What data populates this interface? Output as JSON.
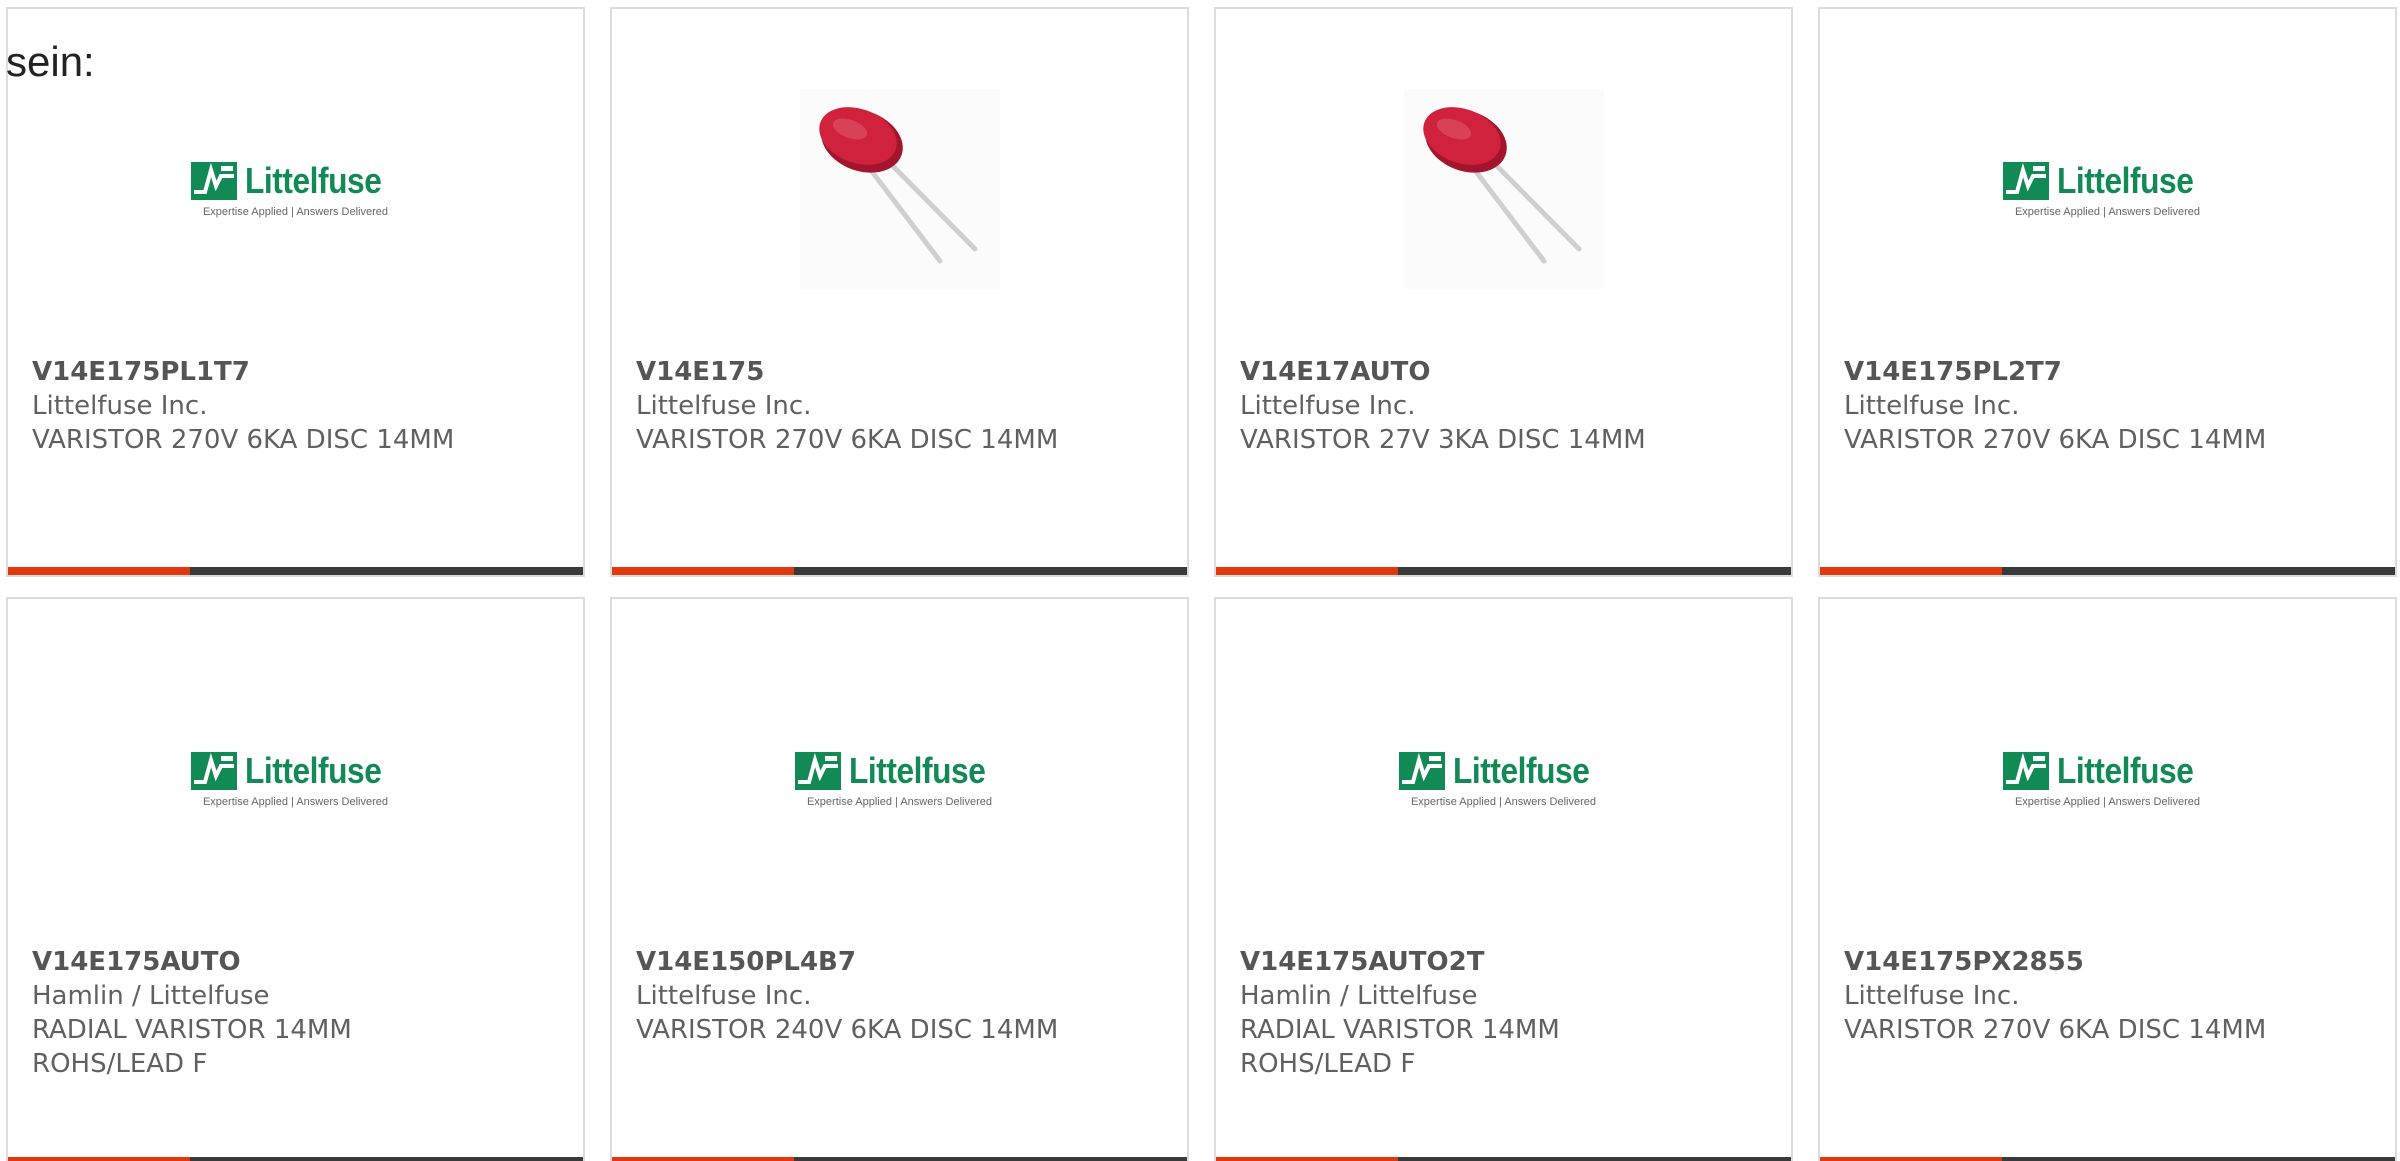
{
  "intro_text": "sein:",
  "brand": {
    "logo_word": "Littelfuse",
    "tagline": "Expertise Applied | Answers Delivered"
  },
  "colors": {
    "accent": "#e2380f",
    "bar": "#3a3a3a",
    "logo_green": "#128a56",
    "varistor_red": "#c81e3a"
  },
  "products": [
    {
      "part": "V14E175PL1T7",
      "manufacturer": "Littelfuse Inc.",
      "desc1": "VARISTOR 270V 6KA DISC 14MM",
      "desc2": "",
      "image": "littelfuse-logo"
    },
    {
      "part": "V14E175",
      "manufacturer": "Littelfuse Inc.",
      "desc1": "VARISTOR 270V 6KA DISC 14MM",
      "desc2": "",
      "image": "varistor-photo"
    },
    {
      "part": "V14E17AUTO",
      "manufacturer": "Littelfuse Inc.",
      "desc1": "VARISTOR 27V 3KA DISC 14MM",
      "desc2": "",
      "image": "varistor-photo"
    },
    {
      "part": "V14E175PL2T7",
      "manufacturer": "Littelfuse Inc.",
      "desc1": "VARISTOR 270V 6KA DISC 14MM",
      "desc2": "",
      "image": "littelfuse-logo"
    },
    {
      "part": "V14E175AUTO",
      "manufacturer": "Hamlin / Littelfuse",
      "desc1": "RADIAL VARISTOR 14MM",
      "desc2": "ROHS/LEAD F",
      "image": "littelfuse-logo"
    },
    {
      "part": "V14E150PL4B7",
      "manufacturer": "Littelfuse Inc.",
      "desc1": "VARISTOR 240V 6KA DISC 14MM",
      "desc2": "",
      "image": "littelfuse-logo"
    },
    {
      "part": "V14E175AUTO2T",
      "manufacturer": "Hamlin / Littelfuse",
      "desc1": "RADIAL VARISTOR 14MM",
      "desc2": "ROHS/LEAD F",
      "image": "littelfuse-logo"
    },
    {
      "part": "V14E175PX2855",
      "manufacturer": "Littelfuse Inc.",
      "desc1": "VARISTOR 270V 6KA DISC 14MM",
      "desc2": "",
      "image": "littelfuse-logo"
    }
  ]
}
